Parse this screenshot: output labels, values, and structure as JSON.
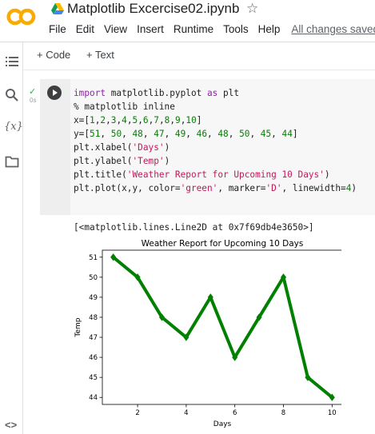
{
  "header": {
    "logo_text": "CO",
    "notebook_title": "Matplotlib Excercise02.ipynb",
    "star_icon": "star-outline-icon",
    "drive_icon": "google-drive-icon",
    "logo_color": "#f9ab00"
  },
  "menu": {
    "file": "File",
    "edit": "Edit",
    "view": "View",
    "insert": "Insert",
    "runtime": "Runtime",
    "tools": "Tools",
    "help": "Help",
    "save_status": "All changes saved"
  },
  "toolbar": {
    "add_code": "+ Code",
    "add_text": "+ Text"
  },
  "sidebar": {
    "icons": [
      "table-of-contents-icon",
      "search-icon",
      "variables-icon",
      "files-icon",
      "code-snippets-icon"
    ],
    "variables_label": "{x}",
    "snippets_label": "<>"
  },
  "cell": {
    "exec_status": "✓",
    "exec_time": "0s",
    "code_lines": [
      "import matplotlib.pyplot as plt",
      "% matplotlib inline",
      "x=[1,2,3,4,5,6,7,8,9,10]",
      "y=[51, 50, 48, 47, 49, 46, 48, 50, 45, 44]",
      "plt.xlabel('Days')",
      "plt.ylabel('Temp')",
      "plt.title('Weather Report for Upcoming 10 Days')",
      "plt.plot(x,y, color='green', marker='D', linewidth=4)"
    ],
    "output_text": "[<matplotlib.lines.Line2D at 0x7f69db4e3650>]"
  },
  "chart_data": {
    "type": "line",
    "title": "Weather Report for Upcoming 10 Days",
    "xlabel": "Days",
    "ylabel": "Temp",
    "x": [
      1,
      2,
      3,
      4,
      5,
      6,
      7,
      8,
      9,
      10
    ],
    "series": [
      {
        "values": [
          51,
          50,
          48,
          47,
          49,
          46,
          48,
          50,
          45,
          44
        ],
        "color": "#008000",
        "marker": "diamond"
      }
    ],
    "xticks": [
      2,
      4,
      6,
      8,
      10
    ],
    "yticks": [
      44,
      45,
      46,
      47,
      48,
      49,
      50,
      51
    ],
    "xlim": [
      0.55,
      10.45
    ],
    "ylim": [
      43.65,
      51.35
    ],
    "grid": false
  }
}
